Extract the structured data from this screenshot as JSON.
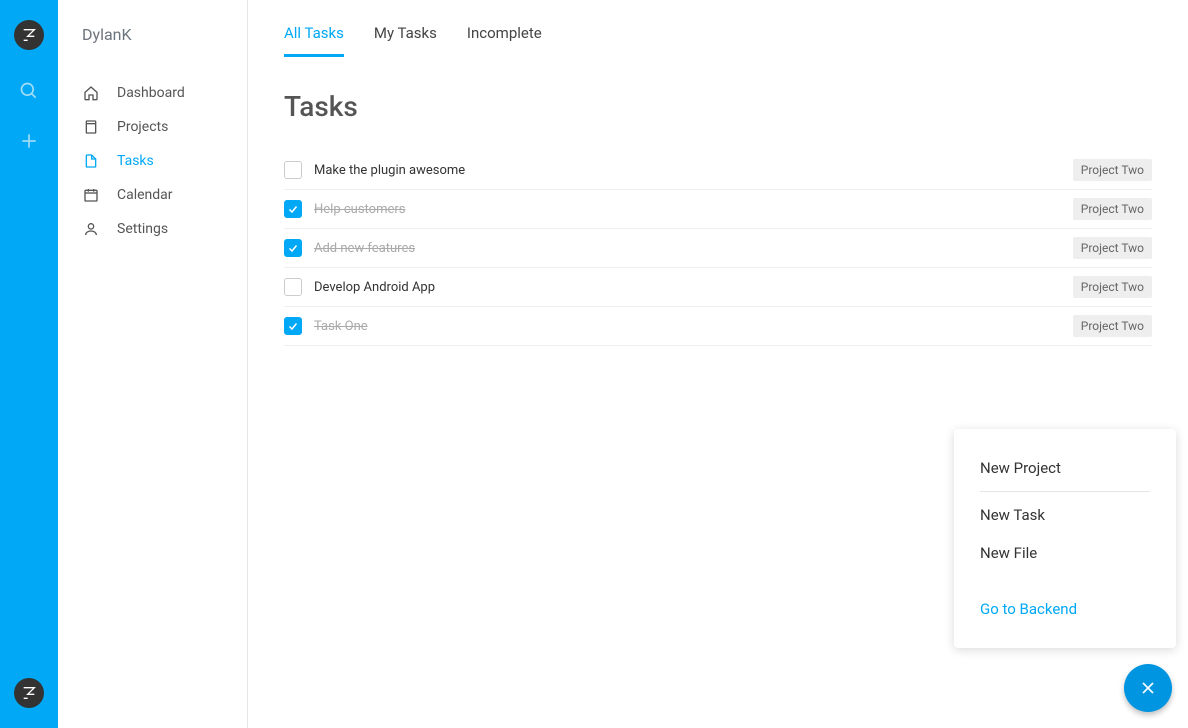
{
  "user": {
    "name": "DylanK"
  },
  "sidebar": {
    "items": [
      {
        "label": "Dashboard",
        "icon": "home"
      },
      {
        "label": "Projects",
        "icon": "book"
      },
      {
        "label": "Tasks",
        "icon": "file"
      },
      {
        "label": "Calendar",
        "icon": "calendar"
      },
      {
        "label": "Settings",
        "icon": "person"
      }
    ],
    "active_index": 2
  },
  "tabs": {
    "items": [
      "All Tasks",
      "My Tasks",
      "Incomplete"
    ],
    "active_index": 0
  },
  "page": {
    "title": "Tasks"
  },
  "tasks": [
    {
      "name": "Make the plugin awesome",
      "done": false,
      "project": "Project Two"
    },
    {
      "name": "Help customers",
      "done": true,
      "project": "Project Two"
    },
    {
      "name": "Add new features",
      "done": true,
      "project": "Project Two"
    },
    {
      "name": "Develop Android App",
      "done": false,
      "project": "Project Two"
    },
    {
      "name": "Task One",
      "done": true,
      "project": "Project Two"
    }
  ],
  "popover": {
    "items": [
      "New Project",
      "New Task",
      "New File"
    ],
    "link": "Go to Backend"
  },
  "colors": {
    "accent": "#00a8f5"
  }
}
